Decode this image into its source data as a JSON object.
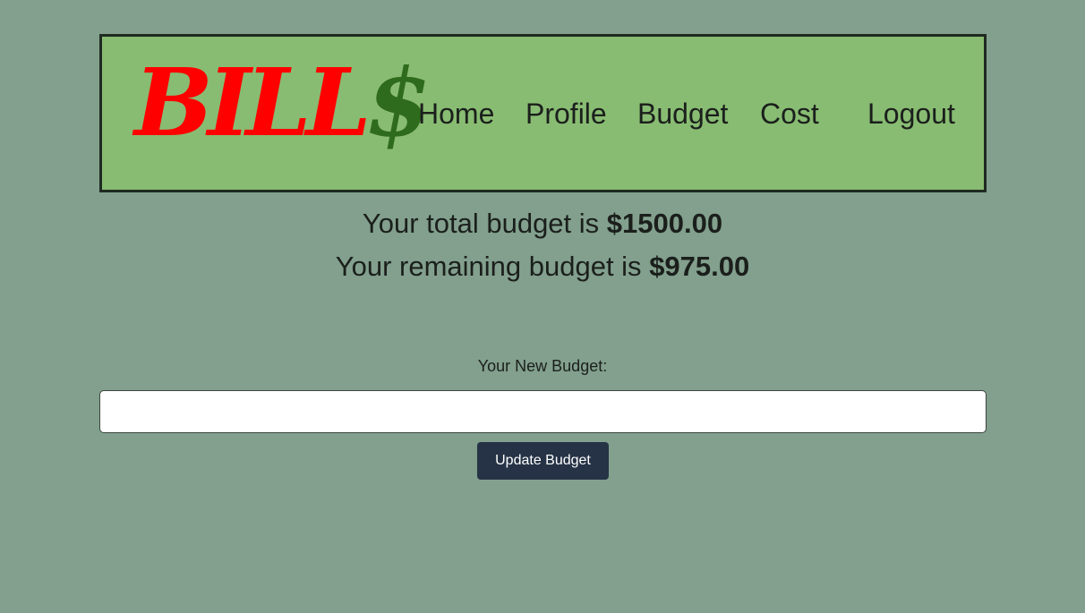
{
  "header": {
    "logo": {
      "letters": "BILL",
      "dollar": "$"
    },
    "nav": {
      "home": "Home",
      "profile": "Profile",
      "budget": "Budget",
      "cost": "Cost",
      "logout": "Logout"
    }
  },
  "summary": {
    "total_prefix": "Your total budget is",
    "total_amount": "$1500.00",
    "remaining_prefix": "Your remaining budget is",
    "remaining_amount": "$975.00"
  },
  "form": {
    "label": "Your New Budget:",
    "input_value": "",
    "button_label": "Update Budget"
  },
  "colors": {
    "background": "#82a08d",
    "header_background": "#88bc72",
    "logo_letters": "#ff0000",
    "logo_dollar": "#2f6b1c",
    "button": "#263346"
  }
}
